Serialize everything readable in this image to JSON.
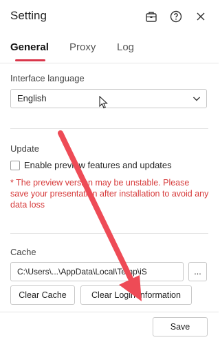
{
  "window": {
    "title": "Setting",
    "icons": [
      "toolbox-icon",
      "help-icon",
      "close-icon"
    ]
  },
  "tabs": [
    {
      "label": "General",
      "active": true
    },
    {
      "label": "Proxy",
      "active": false
    },
    {
      "label": "Log",
      "active": false
    }
  ],
  "interface_language": {
    "label": "Interface language",
    "selected": "English"
  },
  "update": {
    "label": "Update",
    "checkbox_label": "Enable preview features and updates",
    "checked": false,
    "warning": "* The preview version may be unstable. Please save your presentation after installation to avoid any data loss"
  },
  "cache": {
    "label": "Cache",
    "path": "C:\\Users\\...\\AppData\\Local\\Temp\\iS",
    "browse_label": "...",
    "clear_cache_label": "Clear Cache",
    "clear_login_label": "Clear Login Information"
  },
  "footer": {
    "save_label": "Save"
  },
  "colors": {
    "accent": "#d9364a",
    "warning": "#d63a3a",
    "annotation_arrow": "#ee4b56"
  }
}
